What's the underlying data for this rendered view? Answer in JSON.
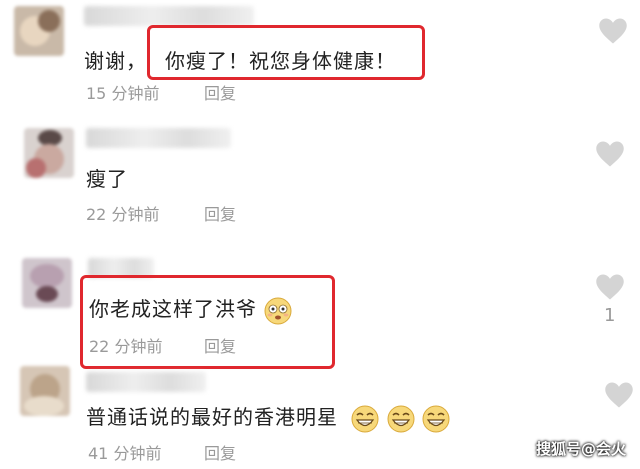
{
  "comments": [
    {
      "text_a": "谢谢，",
      "text_b": "你瘦了！祝您身体健康！",
      "time": "15 分钟前",
      "reply": "回复",
      "likes": ""
    },
    {
      "text": "瘦了",
      "time": "22 分钟前",
      "reply": "回复",
      "likes": ""
    },
    {
      "text": "你老成这样了洪爷",
      "time": "22 分钟前",
      "reply": "回复",
      "likes": "1"
    },
    {
      "text": "普通话说的最好的香港明星",
      "time": "41 分钟前",
      "reply": "回复",
      "likes": ""
    }
  ],
  "watermark": "搜狐号@会火",
  "colors": {
    "highlight": "#e0282e",
    "heart": "#d4d4d4",
    "meta": "#9a9a9a"
  },
  "icons": {
    "like": "heart-icon",
    "emoji_flushed": "flushed-face-emoji",
    "emoji_grin": "grinning-face-emoji"
  }
}
